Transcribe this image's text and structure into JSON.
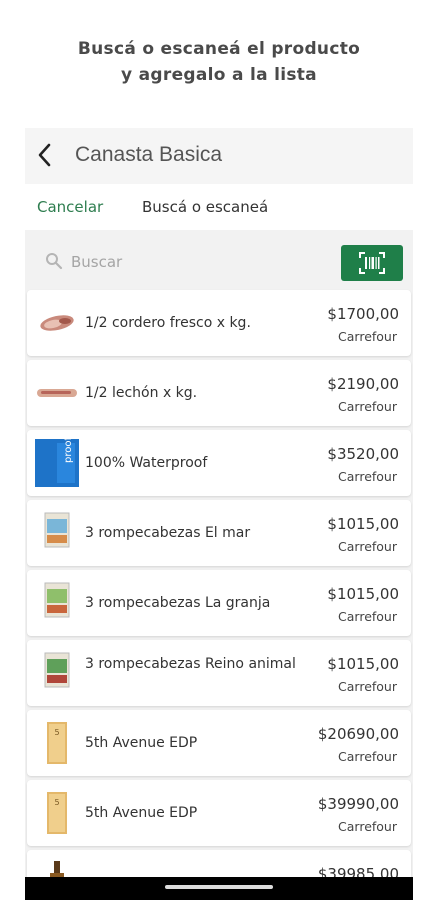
{
  "headline": {
    "line1": "Buscá o escaneá el producto",
    "line2": "y agregalo a la lista"
  },
  "topbar": {
    "title": "Canasta Basica",
    "back_icon": "chevron-left-icon"
  },
  "actionbar": {
    "cancel_label": "Cancelar",
    "title": "Buscá o escaneá"
  },
  "search": {
    "placeholder": "Buscar",
    "value": "",
    "icon": "search-icon",
    "scan_icon": "barcode-scan-icon"
  },
  "colors": {
    "accent": "#1f7f49",
    "link": "#2e7d4f"
  },
  "products": [
    {
      "name": "1/2 cordero fresco x kg.",
      "price": "$1700,00",
      "store": "Carrefour",
      "thumb": "meat"
    },
    {
      "name": "1/2 lechón x kg.",
      "price": "$2190,00",
      "store": "Carrefour",
      "thumb": "pork"
    },
    {
      "name": "100% Waterproof",
      "price": "$3520,00",
      "store": "Carrefour",
      "thumb": "waterproof"
    },
    {
      "name": "3 rompecabezas El mar",
      "price": "$1015,00",
      "store": "Carrefour",
      "thumb": "puzzle"
    },
    {
      "name": "3 rompecabezas La granja",
      "price": "$1015,00",
      "store": "Carrefour",
      "thumb": "puzzle"
    },
    {
      "name": "3 rompecabezas Reino animal",
      "price": "$1015,00",
      "store": "Carrefour",
      "thumb": "puzzle"
    },
    {
      "name": "5th Avenue EDP",
      "price": "$20690,00",
      "store": "Carrefour",
      "thumb": "perfume"
    },
    {
      "name": "5th Avenue EDP",
      "price": "$39990,00",
      "store": "Carrefour",
      "thumb": "perfume"
    },
    {
      "name": "",
      "price": "$39985,00",
      "store": "",
      "thumb": "bottle"
    }
  ]
}
